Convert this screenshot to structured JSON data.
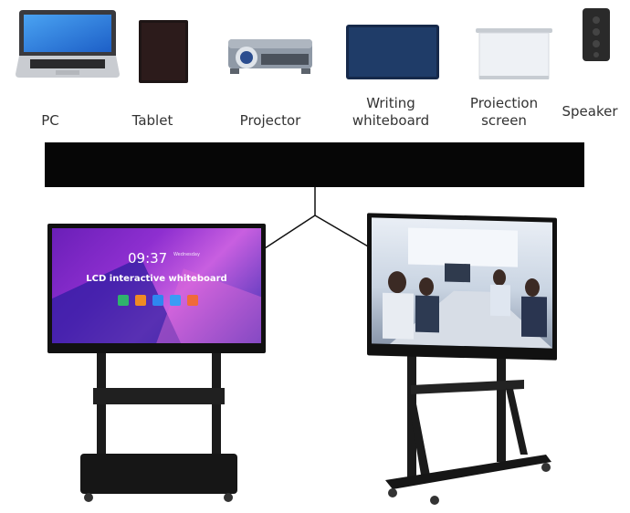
{
  "devices": [
    {
      "id": "pc",
      "label": "PC",
      "icon": "laptop-icon"
    },
    {
      "id": "tablet",
      "label": "Tablet",
      "icon": "tablet-icon"
    },
    {
      "id": "projector",
      "label": "Projector",
      "icon": "projector-icon"
    },
    {
      "id": "whiteboard",
      "label_line1": "Writing",
      "label_line2": "whiteboard",
      "icon": "whiteboard-icon"
    },
    {
      "id": "screen",
      "label_line1": "Proiection",
      "label_line2": "screen",
      "icon": "projection-screen-icon"
    },
    {
      "id": "speaker",
      "label": "Speaker",
      "icon": "speaker-icon"
    }
  ],
  "left_display": {
    "time": "09:37",
    "day": "Wednesday",
    "title": "LCD interactive whiteboard",
    "app_colors": [
      "#2fb36d",
      "#f08a24",
      "#2f86f0",
      "#3a9cf5",
      "#f06a3a"
    ]
  },
  "right_display": {
    "scene": "meeting-room-icon"
  },
  "colors": {
    "bar": "#060606",
    "label": "#333333"
  }
}
